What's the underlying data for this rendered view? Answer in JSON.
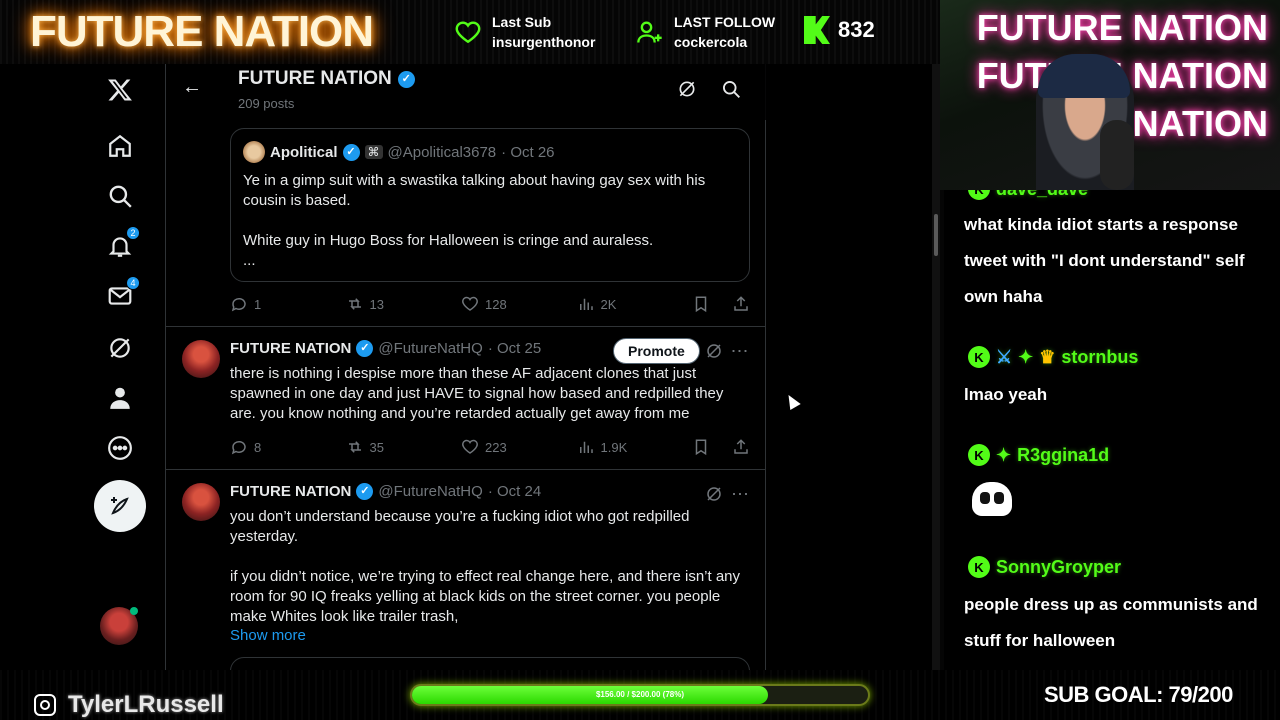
{
  "overlay": {
    "brand": "FUTURE NATION",
    "last_sub_label": "Last Sub",
    "last_sub_value": "insurgenthonor",
    "last_follow_label": "LAST FOLLOW",
    "last_follow_value": "cockercola",
    "kick_count": "832",
    "cam_text_1": "FUTURE NATION",
    "cam_text_2": "FUTURE NATION",
    "cam_text_3": "NATION",
    "instagram_handle": "TylerLRussell",
    "goal_text": "$156.00 / $200.00 (78%)",
    "goal_progress": 0.78,
    "sub_goal": "SUB GOAL: 79/200"
  },
  "nav": {
    "notifications_badge": "2",
    "messages_badge": "4"
  },
  "profile_header": {
    "name": "FUTURE NATION",
    "posts": "209 posts"
  },
  "quote": {
    "name": "Apolitical",
    "handle": "@Apolitical3678",
    "date": "· Oct 26",
    "text": "Ye in a gimp suit with a swastika talking about having gay sex with his cousin is based.\n\nWhite guy in Hugo Boss for Halloween is cringe and auraless.\n...",
    "replies": "1",
    "reposts": "13",
    "likes": "128",
    "views": "2K"
  },
  "tweets": [
    {
      "name": "FUTURE NATION",
      "handle": "@FutureNatHQ",
      "date": "· Oct 25",
      "promote": "Promote",
      "text": "there is nothing i despise more than these AF adjacent clones that just spawned in one day and just HAVE to signal how based and redpilled they are. you know nothing and you’re retarded actually get away from me",
      "replies": "8",
      "reposts": "35",
      "likes": "223",
      "views": "1.9K"
    },
    {
      "name": "FUTURE NATION",
      "handle": "@FutureNatHQ",
      "date": "· Oct 24",
      "text": "you don’t understand because you’re a fucking idiot who got redpilled yesterday.\n\nif you didn’t notice, we’re trying to effect real change here, and there isn’t any room for 90 IQ freaks yelling at black kids on the street corner. you people make Whites look like trailer trash,",
      "show_more": "Show more"
    }
  ],
  "chat": [
    {
      "user": "dave_dave",
      "text": "what kinda idiot starts a response tweet with \"I dont understand\" self own haha"
    },
    {
      "user": "stornbus",
      "text": "lmao yeah"
    },
    {
      "user": "R3ggina1d",
      "text": ""
    },
    {
      "user": "SonnyGroyper",
      "text": "people dress up as communists and stuff for halloween"
    }
  ],
  "colors": {
    "kick_green": "#53fc18",
    "x_blue": "#1d9bf0",
    "x_border": "#2f3336",
    "muted": "#71767b"
  }
}
